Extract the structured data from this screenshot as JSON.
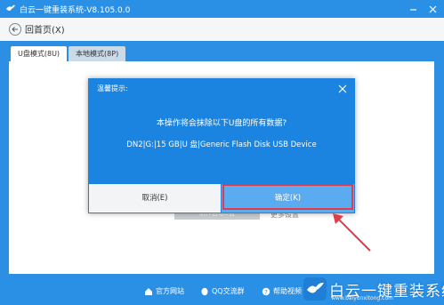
{
  "window": {
    "title": "白云一键重装系统-V8.105.0.0"
  },
  "toolbar": {
    "back_label": "回首页(X)"
  },
  "tabs": [
    {
      "label": "U盘模式(8U)"
    },
    {
      "label": "本地模式(8P)"
    }
  ],
  "background": {
    "make_button": "制作启动U盘",
    "more_settings": "更多设置"
  },
  "dialog": {
    "title": "温馨提示:",
    "message": "本操作将会抹除以下U盘的所有数据?",
    "device": "DN2|G:|15 GB|U 盘|Generic Flash Disk USB Device",
    "cancel": "取消(E)",
    "confirm": "确定(K)"
  },
  "footer": {
    "links": [
      {
        "label": "官方网站",
        "icon": "home-icon"
      },
      {
        "label": "QQ交流群",
        "icon": "qq-icon"
      },
      {
        "label": "帮助视频",
        "icon": "help-icon"
      }
    ]
  },
  "watermark": {
    "name": "白云一键重装系统",
    "url": "www.baiyunxitong.com"
  },
  "colors": {
    "accent": "#1a84e0",
    "highlight": "#e23b4a",
    "confirm": "#5aabf0"
  }
}
